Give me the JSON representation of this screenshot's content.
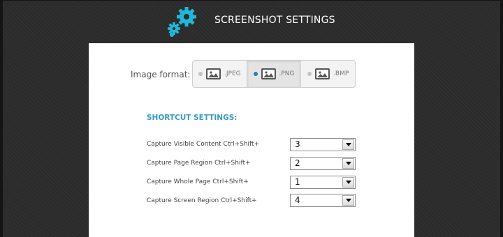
{
  "header": {
    "title": "SCREENSHOT SETTINGS",
    "icon": "gears-icon",
    "accent": "#1fb8d8"
  },
  "image_format": {
    "label": "Image format:",
    "options": [
      {
        "ext": ".JPEG",
        "selected": false
      },
      {
        "ext": ".PNG",
        "selected": true
      },
      {
        "ext": ".BMP",
        "selected": false
      }
    ]
  },
  "shortcuts": {
    "title": "SHORTCUT SETTINGS:",
    "rows": [
      {
        "label": "Capture Visible Content Ctrl+Shift+",
        "value": "3"
      },
      {
        "label": "Capture Page Region Ctrl+Shift+",
        "value": "2"
      },
      {
        "label": "Capture Whole Page Ctrl+Shift+",
        "value": "1"
      },
      {
        "label": "Capture Screen Region Ctrl+Shift+",
        "value": "4"
      }
    ]
  }
}
